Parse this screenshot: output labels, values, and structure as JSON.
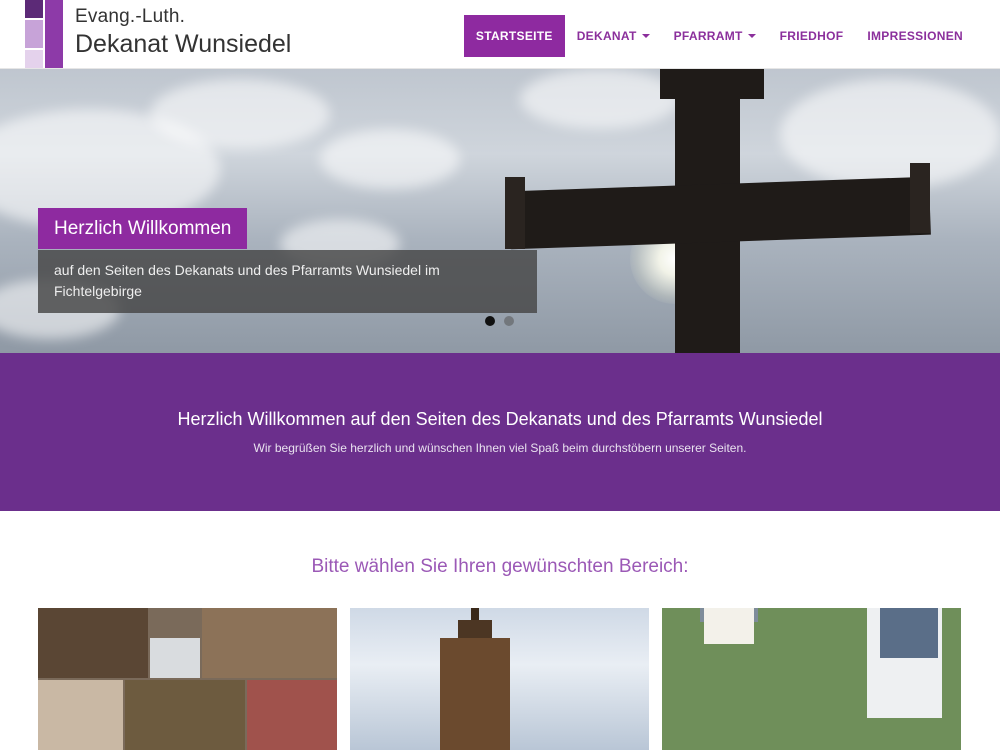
{
  "site": {
    "title_line1": "Evang.-Luth.",
    "title_line2": "Dekanat Wunsiedel",
    "brand_color": "#8e2aa0"
  },
  "nav": {
    "items": [
      {
        "label": "STARTSEITE",
        "active": true,
        "dropdown": false
      },
      {
        "label": "DEKANAT",
        "active": false,
        "dropdown": true
      },
      {
        "label": "PFARRAMT",
        "active": false,
        "dropdown": true
      },
      {
        "label": "FRIEDHOF",
        "active": false,
        "dropdown": false
      },
      {
        "label": "IMPRESSIONEN",
        "active": false,
        "dropdown": false
      }
    ]
  },
  "hero": {
    "caption_title": "Herzlich Willkommen",
    "caption_text": "auf den Seiten des Dekanats und des Pfarramts Wunsiedel im Fichtelgebirge",
    "slides_count": 2,
    "active_slide": 1
  },
  "welcome": {
    "heading": "Herzlich Willkommen auf den Seiten des Dekanats und des Pfarramts Wunsiedel",
    "subtext": "Wir begrüßen Sie herzlich und wünschen Ihnen viel Spaß beim durchstöbern unserer Seiten.",
    "background_color": "#6b2f8c"
  },
  "section": {
    "title": "Bitte wählen Sie Ihren gewünschten Bereich:"
  }
}
